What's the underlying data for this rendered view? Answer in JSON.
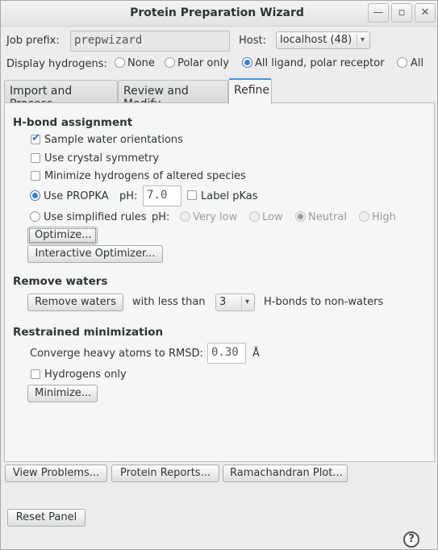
{
  "window": {
    "title": "Protein Preparation Wizard"
  },
  "top": {
    "job_prefix_label": "Job prefix:",
    "job_prefix_value": "prepwizard",
    "host_label": "Host:",
    "host_value": "localhost (48)",
    "display_h_label": "Display hydrogens:",
    "display_h_options": [
      "None",
      "Polar only",
      "All ligand, polar receptor",
      "All"
    ],
    "display_h_selected": "All ligand, polar receptor"
  },
  "tabs": [
    "Import and Process",
    "Review and Modify",
    "Refine"
  ],
  "active_tab": "Refine",
  "hbond": {
    "title": "H-bond assignment",
    "sample_water": "Sample water orientations",
    "sample_water_checked": true,
    "crystal_symmetry": "Use crystal symmetry",
    "minimize_h": "Minimize hydrogens of altered species",
    "use_propka": "Use PROPKA",
    "ph_label": "pH:",
    "ph_value": "7.0",
    "label_pkas": "Label pKas",
    "simplified": "Use simplified rules",
    "ph_label2": "pH:",
    "ph_options": [
      "Very low",
      "Low",
      "Neutral",
      "High"
    ],
    "ph_selected": "Neutral",
    "optimize_btn": "Optimize...",
    "interactive_btn": "Interactive Optimizer..."
  },
  "waters": {
    "title": "Remove waters",
    "remove_btn": "Remove waters",
    "with_less": "with less than",
    "hbond_count": "3",
    "hbond_suffix": "H-bonds to non-waters"
  },
  "minimization": {
    "title": "Restrained minimization",
    "converge_label": "Converge heavy atoms to RMSD:",
    "rmsd_value": "0.30",
    "rmsd_unit": "Å",
    "hydrogens_only": "Hydrogens only",
    "minimize_btn": "Minimize..."
  },
  "bottom": {
    "view_problems": "View Problems...",
    "protein_reports": "Protein Reports...",
    "ramachandran": "Ramachandran Plot...",
    "reset_panel": "Reset Panel",
    "help": "?"
  }
}
